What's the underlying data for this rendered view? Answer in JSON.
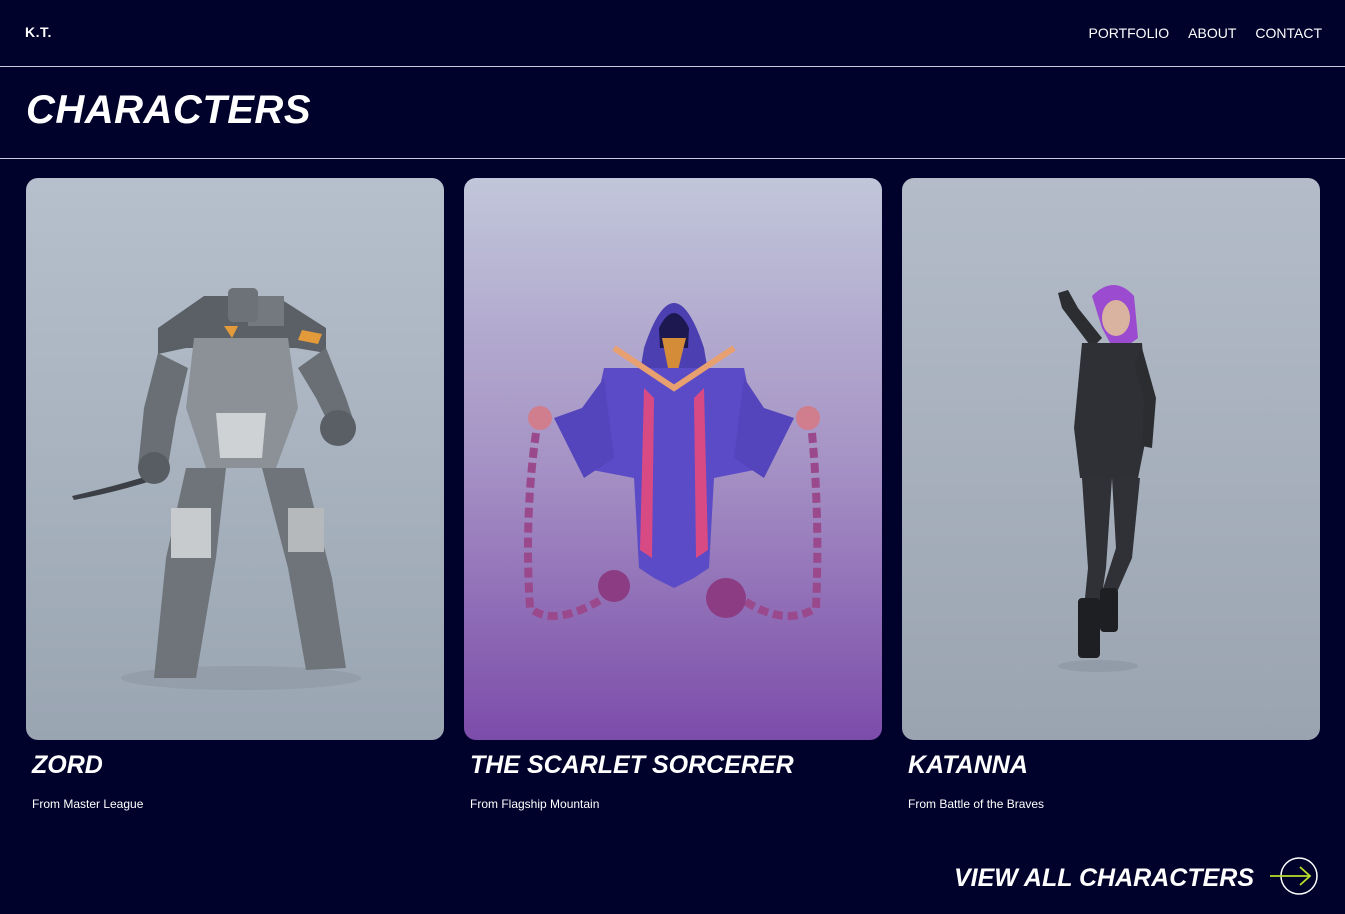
{
  "brand": {
    "logo": "K.T."
  },
  "nav": {
    "items": [
      {
        "label": "PORTFOLIO"
      },
      {
        "label": "ABOUT"
      },
      {
        "label": "CONTACT"
      }
    ]
  },
  "page": {
    "title": "CHARACTERS"
  },
  "cards": [
    {
      "name": "ZORD",
      "source": "From Master League",
      "image_icon": "robot-character-image"
    },
    {
      "name": "THE SCARLET SORCERER",
      "source": "From Flagship Mountain",
      "image_icon": "sorcerer-character-image"
    },
    {
      "name": "KATANNA",
      "source": "From Battle of the Braves",
      "image_icon": "katanna-character-image"
    }
  ],
  "cta": {
    "label": "VIEW ALL CHARACTERS",
    "icon": "arrow-right-circle-icon",
    "accent": "#b7e12a"
  },
  "colors": {
    "background": "#00022b",
    "divider": "#c9cbe0",
    "text": "#ffffff"
  }
}
